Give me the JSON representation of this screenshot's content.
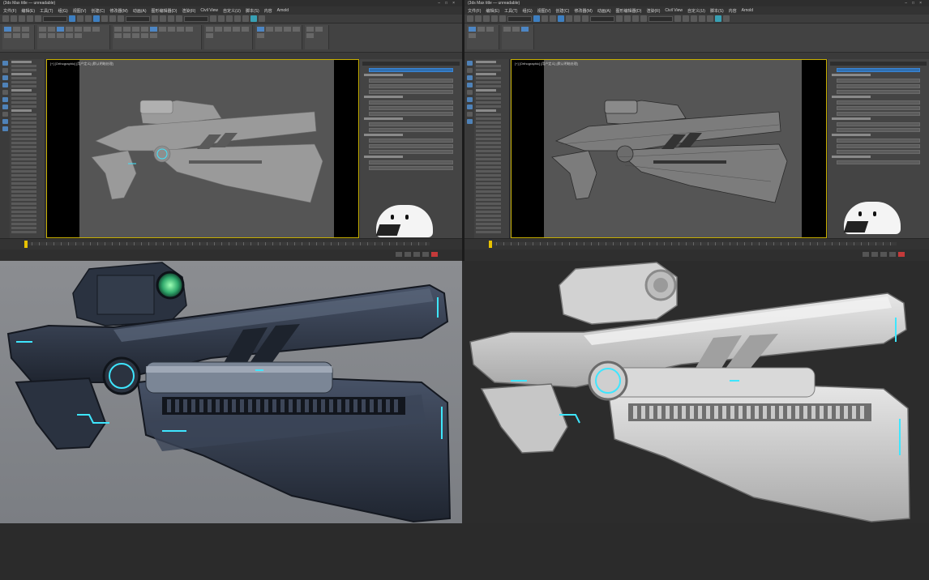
{
  "left_window": {
    "title": "(3ds Max title — unreadable)",
    "menu": [
      "文件(F)",
      "编辑(E)",
      "工具(T)",
      "组(G)",
      "视图(V)",
      "创建(C)",
      "修改器(M)",
      "动画(A)",
      "图形编辑器(D)",
      "渲染(R)",
      "Civil View",
      "自定义(U)",
      "脚本(S)",
      "内容",
      "Arnold"
    ],
    "viewport_label": "[+] [Orthographic] [用户定义] [默认明暗处理]"
  },
  "right_window": {
    "title": "(3ds Max title — unreadable)",
    "menu": [
      "文件(F)",
      "编辑(E)",
      "工具(T)",
      "组(G)",
      "视图(V)",
      "创建(C)",
      "修改器(M)",
      "动画(A)",
      "图形编辑器(D)",
      "渲染(R)",
      "Civil View",
      "自定义(U)",
      "脚本(S)",
      "内容",
      "Arnold"
    ],
    "viewport_label": "[+] [Orthographic] [用户定义] [默认明暗处理]"
  },
  "colors": {
    "accent_blue": "#3d7fc1",
    "viewport_border": "#c8b000",
    "render_left_bg": "#878a8f",
    "render_right_bg": "#2c2c2c",
    "glow_cyan": "#3ee6ff",
    "dark_gun": "#2c3544",
    "clay_gun": "#c9c9c9"
  }
}
